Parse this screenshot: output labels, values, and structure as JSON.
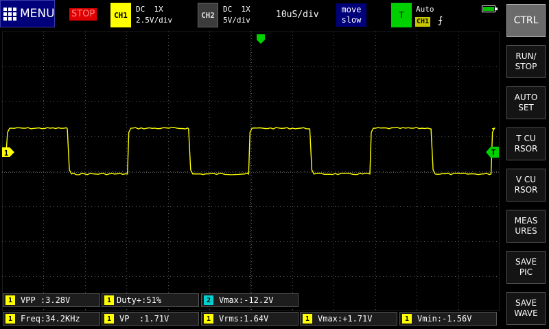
{
  "topbar": {
    "menu_label": "MENU",
    "run_state": "STOP",
    "ch1": {
      "label": "CH1",
      "coupling": "DC  1X",
      "scale": "2.5V/div"
    },
    "ch2": {
      "label": "CH2",
      "coupling": "DC  1X",
      "scale": "5V/div"
    },
    "timebase": "10uS/div",
    "move_line1": "move",
    "move_line2": "slow",
    "trigger": {
      "label": "T",
      "mode": "Auto",
      "source": "CH1",
      "edge": "⨍"
    }
  },
  "side_buttons": [
    {
      "label": "CTRL"
    },
    {
      "label": "RUN/\nSTOP"
    },
    {
      "label": "AUTO\nSET"
    },
    {
      "label": "T CU\nRSOR"
    },
    {
      "label": "V CU\nRSOR"
    },
    {
      "label": "MEAS\nURES"
    },
    {
      "label": "SAVE\nPIC"
    },
    {
      "label": "SAVE\nWAVE"
    }
  ],
  "markers": {
    "ch1_marker": "1",
    "trigger_level_marker": "T"
  },
  "measurements": [
    {
      "channel": "1",
      "text": "VPP :3.28V"
    },
    {
      "channel": "1",
      "text": "Duty+:51%"
    },
    {
      "channel": "2",
      "text": "Vmax:-12.2V"
    },
    {
      "channel": "1",
      "text": "Freq:34.2KHz"
    },
    {
      "channel": "1",
      "text": "VP  :1.71V"
    },
    {
      "channel": "1",
      "text": "Vrms:1.64V"
    },
    {
      "channel": "1",
      "text": "Vmax:+1.71V"
    },
    {
      "channel": "1",
      "text": "Vmin:-1.56V"
    }
  ],
  "colors": {
    "ch1": "#ffff00",
    "ch2": "#00d0d0",
    "trigger": "#00d000",
    "menu": "#00007a",
    "stop": "#e00000"
  },
  "waveform": {
    "shape": "square",
    "frequency_khz": 34.2,
    "duty_pct": 51,
    "vmax_v": 1.71,
    "vmin_v": -1.56,
    "volts_per_div": 2.5,
    "time_per_div_us": 10
  }
}
